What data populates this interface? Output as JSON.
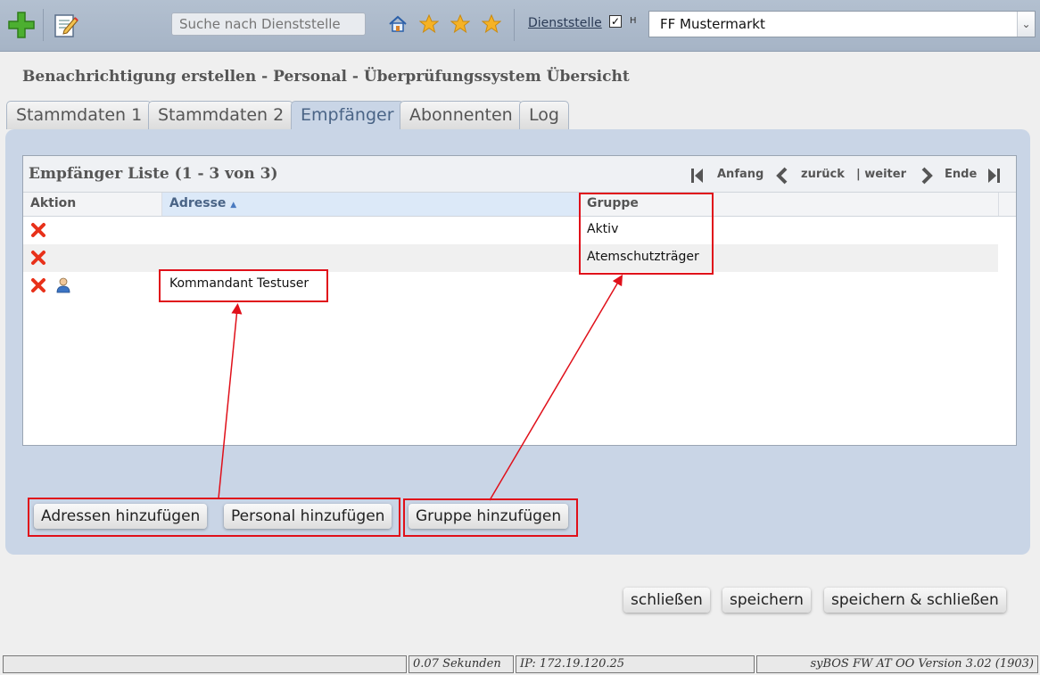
{
  "toolbar": {
    "search_placeholder": "Suche nach Dienststelle",
    "dienststelle_link": "Dienststelle",
    "checkbox_mark": "✓",
    "mini_label": "H",
    "selected_dienststelle": "FF Mustermarkt",
    "select_arrow": "⌄"
  },
  "page": {
    "title": "Benachrichtigung erstellen - Personal - Überprüfungssystem Übersicht"
  },
  "tabs": [
    {
      "label": "Stammdaten 1"
    },
    {
      "label": "Stammdaten 2"
    },
    {
      "label": "Empfänger"
    },
    {
      "label": "Abonnenten"
    },
    {
      "label": "Log"
    }
  ],
  "list": {
    "title": "Empfänger Liste (1 - 3 von 3)",
    "pager": {
      "first": "Anfang",
      "prev": "zurück",
      "next": "| weiter",
      "last": "Ende"
    },
    "columns": {
      "aktion": "Aktion",
      "adresse": "Adresse",
      "gruppe": "Gruppe"
    },
    "rows": [
      {
        "adresse": "",
        "gruppe": "Aktiv"
      },
      {
        "adresse": "",
        "gruppe": "Atemschutzträger"
      },
      {
        "adresse": "Kommandant Testuser",
        "gruppe": ""
      }
    ]
  },
  "actions": {
    "add_addresses": "Adressen hinzufügen",
    "add_personal": "Personal hinzufügen",
    "add_group": "Gruppe hinzufügen"
  },
  "footer_buttons": {
    "close": "schließen",
    "save": "speichern",
    "save_close": "speichern & schließen"
  },
  "statusbar": {
    "time": "0.07 Sekunden",
    "ip": "IP: 172.19.120.25",
    "version": "syBOS FW AT OO Version 3.02 (1903)"
  },
  "colors": {
    "toolbar_bg": "#a6b4c6",
    "panel_bg": "#c9d5e6",
    "annotation_red": "#e0101a",
    "delete_red": "#e8311a"
  }
}
